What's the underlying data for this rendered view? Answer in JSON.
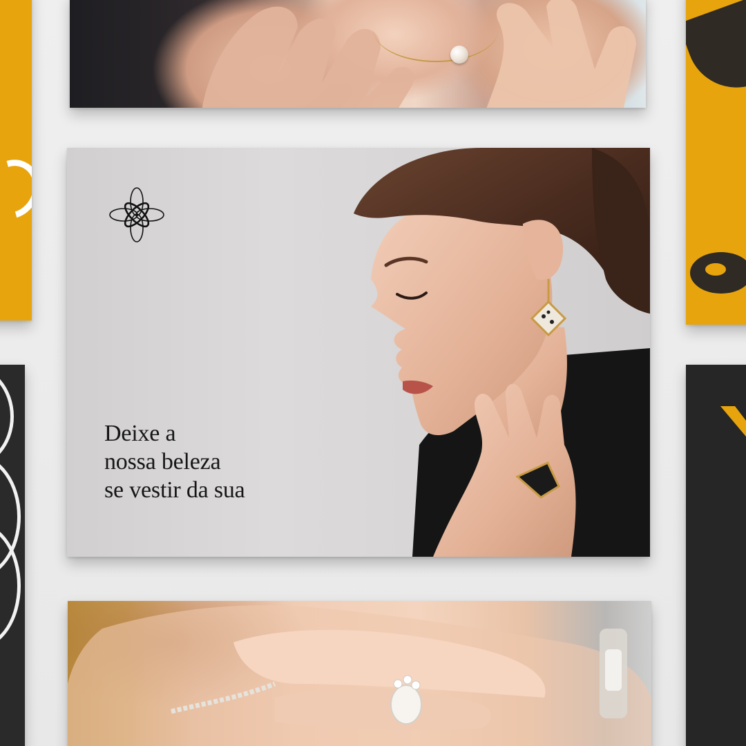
{
  "hero": {
    "tagline_lines": [
      "Deixe a",
      "nossa beleza",
      "se vestir da sua"
    ],
    "logo_icon": "flower-logo-icon",
    "photo_subject": "woman-earring-portrait"
  },
  "top_card": {
    "photo_subject": "pearl-necklace-hands"
  },
  "bottom_card": {
    "photo_subject": "diamond-ring-hands"
  },
  "colors": {
    "accent_yellow": "#e8a40c",
    "dark": "#2a2a2a",
    "background": "#ececec",
    "text": "#161616"
  }
}
